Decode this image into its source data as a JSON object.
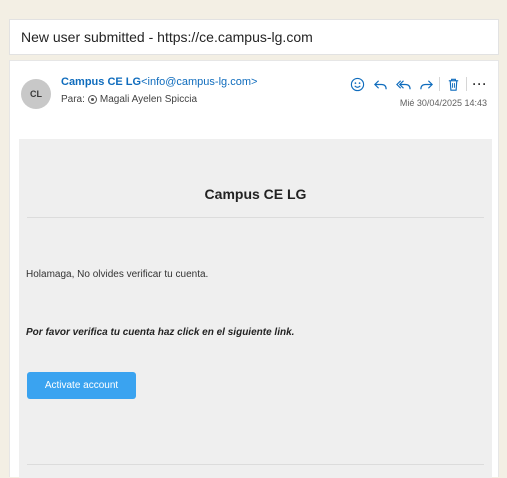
{
  "subject": "New user submitted - https://ce.campus-lg.com",
  "message": {
    "avatar_initials": "CL",
    "sender_name": "Campus CE LG",
    "sender_email": "<info@campus-lg.com>",
    "to_label": "Para:",
    "to_name": "Magali Ayelen Spiccia",
    "date": "Mié 30/04/2025 14:43",
    "more_label": "···"
  },
  "email_body": {
    "brand_title": "Campus CE LG",
    "greeting": "Holamaga, No olvides verificar tu cuenta.",
    "instruction": "Por favor verifica tu cuenta haz click en el siguiente link.",
    "button_label": "Activate account"
  },
  "colors": {
    "accent": "#0f6cbd",
    "button": "#3aa3f0",
    "background": "#f3efe4"
  },
  "icons": [
    "emoji-icon",
    "reply-icon",
    "reply-all-icon",
    "forward-icon",
    "delete-icon",
    "more-icon"
  ]
}
